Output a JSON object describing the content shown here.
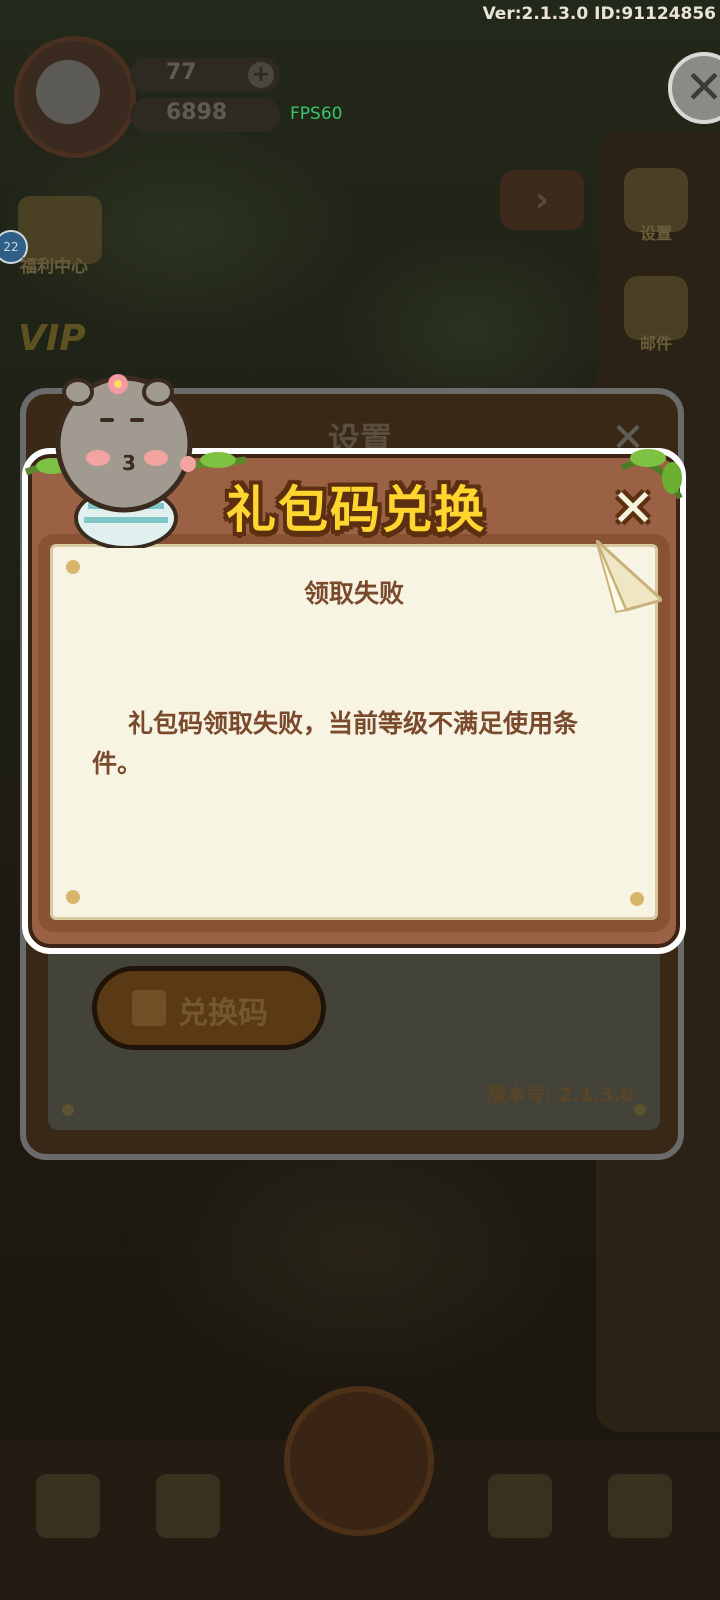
{
  "header": {
    "version_id": "Ver:2.1.3.0 ID:91124856",
    "fps": "FPS60",
    "resource_1": "77",
    "resource_2": "6898",
    "resource_plus": "+"
  },
  "sidebar": {
    "settings_label": "设置",
    "mail_label": "邮件"
  },
  "welfare": {
    "label": "福利中心",
    "badge": "22",
    "vip": "VIP"
  },
  "settings_dialog": {
    "title": "设置",
    "redeem_button": "兑换码",
    "version": "版本号: 2.1.3.0"
  },
  "gift_popup": {
    "title": "礼包码兑换",
    "close": "✕",
    "heading": "领取失败",
    "message": "礼包码领取失败，当前等级不满足使用条件。"
  },
  "colors": {
    "title_yellow": "#ffd52e",
    "frame_brown": "#9a6144",
    "paper": "#f8f4e4",
    "text_brown": "#7a4a2c"
  }
}
